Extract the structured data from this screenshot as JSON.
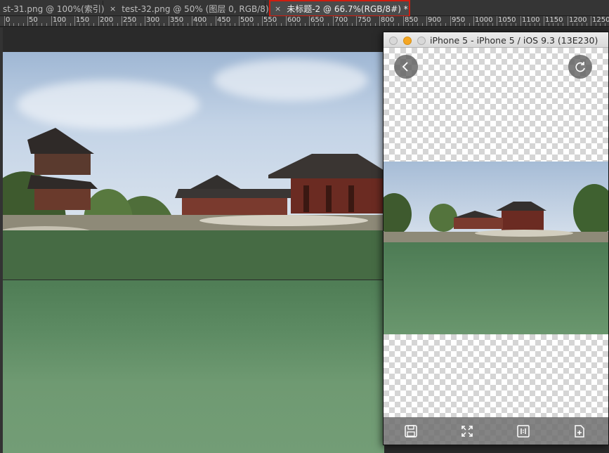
{
  "tabs": [
    {
      "label": "st-31.png @ 100%(索引)",
      "close": ""
    },
    {
      "label": "test-32.png @ 50% (图层 0, RGB/8)",
      "close": "×"
    },
    {
      "label": "未标题-2 @ 66.7%(RGB/8#) *",
      "close": "×"
    }
  ],
  "ruler": {
    "labels": [
      "0",
      "50",
      "100",
      "150",
      "200",
      "250",
      "300",
      "350",
      "400",
      "450",
      "500",
      "550",
      "600",
      "650",
      "700",
      "750",
      "800",
      "850",
      "900",
      "950",
      "1000",
      "1050",
      "1100",
      "1150",
      "1200",
      "1250"
    ]
  },
  "simulator": {
    "title": "iPhone 5 - iPhone 5 / iOS 9.3 (13E230)",
    "buttons": {
      "back": "back-icon",
      "refresh": "refresh-icon"
    },
    "toolbar": [
      "save-icon",
      "fit-screen-icon",
      "actual-size-icon",
      "new-document-icon"
    ]
  },
  "colors": {
    "active_tab_border": "#d01c0e",
    "traffic_minimize": "#f5a623"
  }
}
